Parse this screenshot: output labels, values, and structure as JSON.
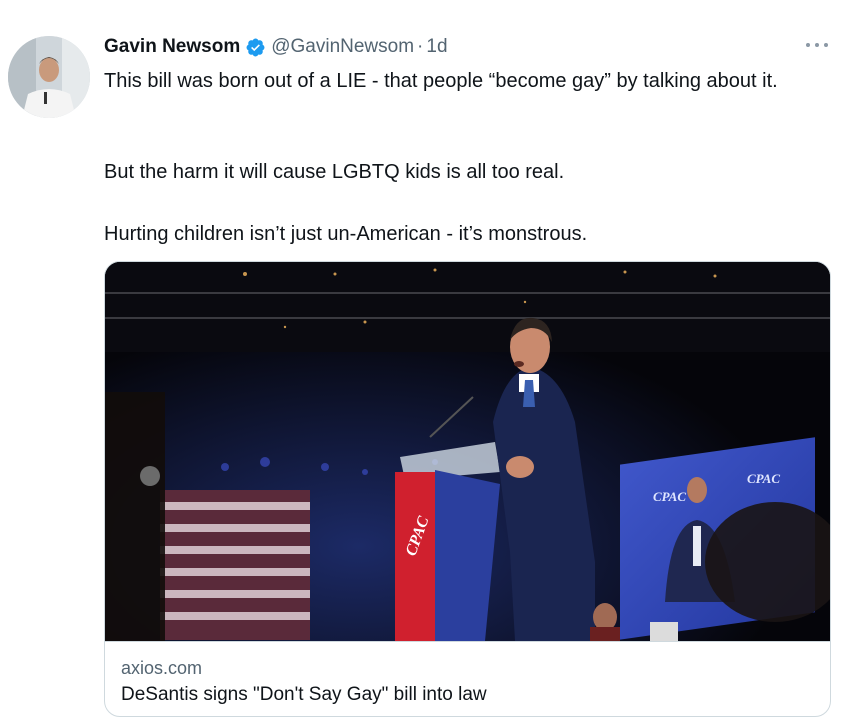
{
  "author": {
    "display_name": "Gavin Newsom",
    "handle": "@GavinNewsom",
    "separator": "·",
    "time": "1d"
  },
  "tweet": {
    "paragraphs": [
      "This bill was born out of a LIE - that people “become gay” by talking about it.",
      "But the harm it will cause LGBTQ kids is all too real.",
      "Hurting children isn’t just un-American - it’s monstrous."
    ]
  },
  "card": {
    "domain": "axios.com",
    "title": "DeSantis signs \"Don't Say Gay\" bill into law",
    "image": {
      "podium_logo": "CPAC",
      "screen_logos": [
        "CPAC",
        "CPAC"
      ]
    }
  },
  "icons": {
    "verified": "verified-badge-icon",
    "more": "more-options-icon"
  },
  "colors": {
    "verified_blue": "#1d9bf0",
    "secondary_text": "#536471",
    "border": "#cfd9de",
    "cpac_red": "#d0202e",
    "cpac_blue": "#2b3f9e"
  }
}
